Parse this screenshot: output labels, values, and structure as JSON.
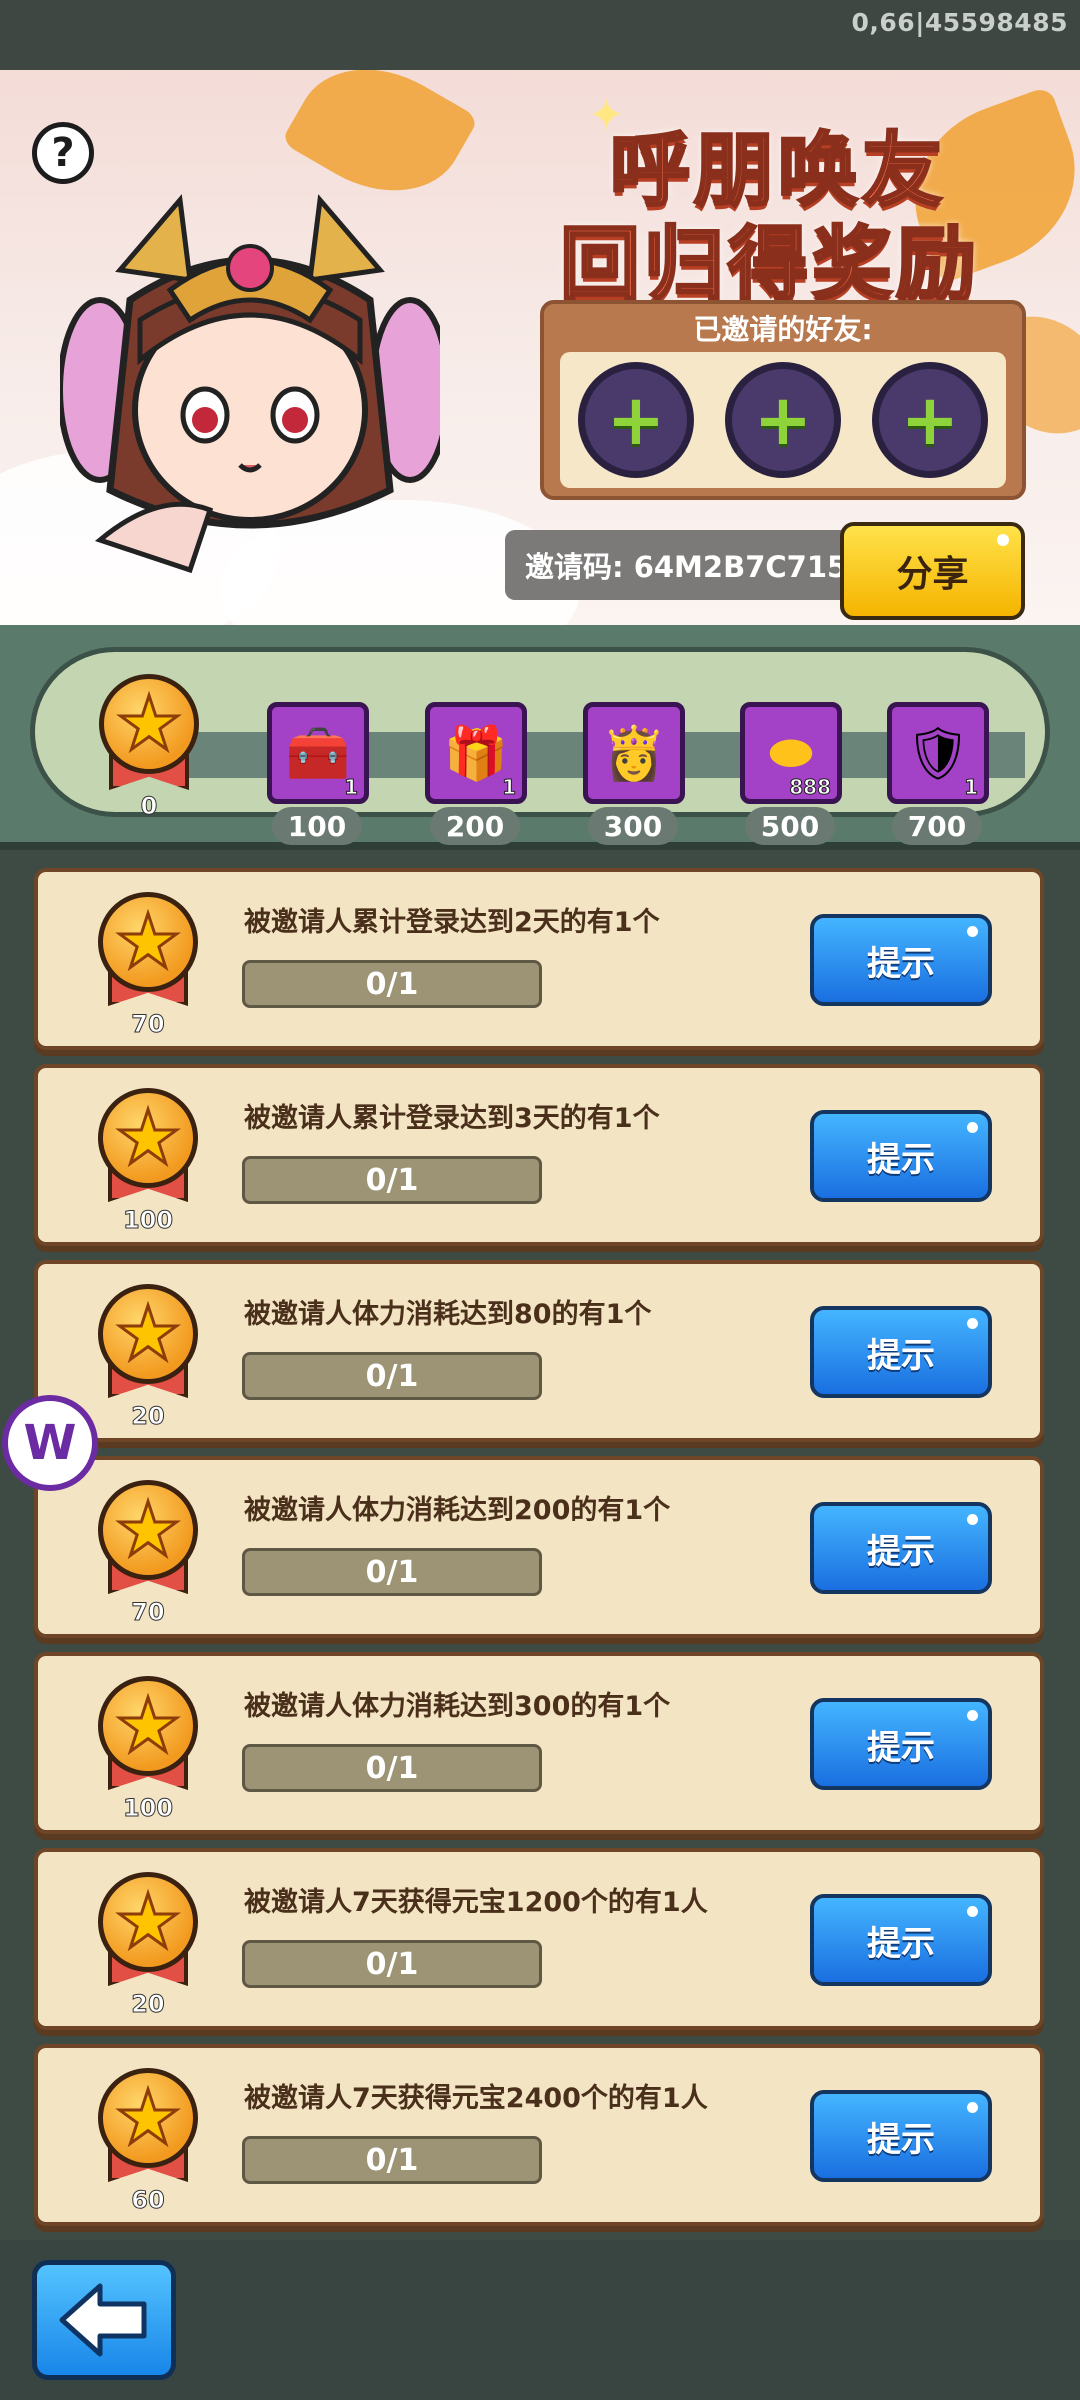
{
  "status": {
    "fps_text": "0,66|45598485"
  },
  "banner": {
    "help_label": "?",
    "title_line1": "呼朋唤友",
    "title_line2": "回归得奖励",
    "friends_label": "已邀请的好友:",
    "friend_slots": [
      "+",
      "+",
      "+"
    ],
    "invite_code": "邀请码: 64M2B7C715",
    "share_label": "分享"
  },
  "progress": {
    "current_points": "0",
    "rewards": [
      {
        "icon": "upgrade-chest-icon",
        "count": "1",
        "threshold": "100"
      },
      {
        "icon": "upgrade-chest-icon",
        "count": "1",
        "threshold": "200"
      },
      {
        "icon": "hero-portrait-icon",
        "count": "",
        "threshold": "300"
      },
      {
        "icon": "gold-ingot-icon",
        "count": "888",
        "threshold": "500"
      },
      {
        "icon": "armor-icon",
        "count": "1",
        "threshold": "700"
      }
    ]
  },
  "tasks": [
    {
      "points": "70",
      "desc": "被邀请人累计登录达到2天的有1个",
      "progress": "0/1",
      "button": "提示"
    },
    {
      "points": "100",
      "desc": "被邀请人累计登录达到3天的有1个",
      "progress": "0/1",
      "button": "提示"
    },
    {
      "points": "20",
      "desc": "被邀请人体力消耗达到80的有1个",
      "progress": "0/1",
      "button": "提示"
    },
    {
      "points": "70",
      "desc": "被邀请人体力消耗达到200的有1个",
      "progress": "0/1",
      "button": "提示"
    },
    {
      "points": "100",
      "desc": "被邀请人体力消耗达到300的有1个",
      "progress": "0/1",
      "button": "提示"
    },
    {
      "points": "20",
      "desc": "被邀请人7天获得元宝1200个的有1人",
      "progress": "0/1",
      "button": "提示"
    },
    {
      "points": "60",
      "desc": "被邀请人7天获得元宝2400个的有1人",
      "progress": "0/1",
      "button": "提示"
    }
  ],
  "colors": {
    "accent_blue": "#1a6fe0",
    "accent_yellow": "#f5b400",
    "panel_green": "#5a7a6b",
    "card_bg": "#f3e5c4"
  },
  "overlay_logo": "W"
}
